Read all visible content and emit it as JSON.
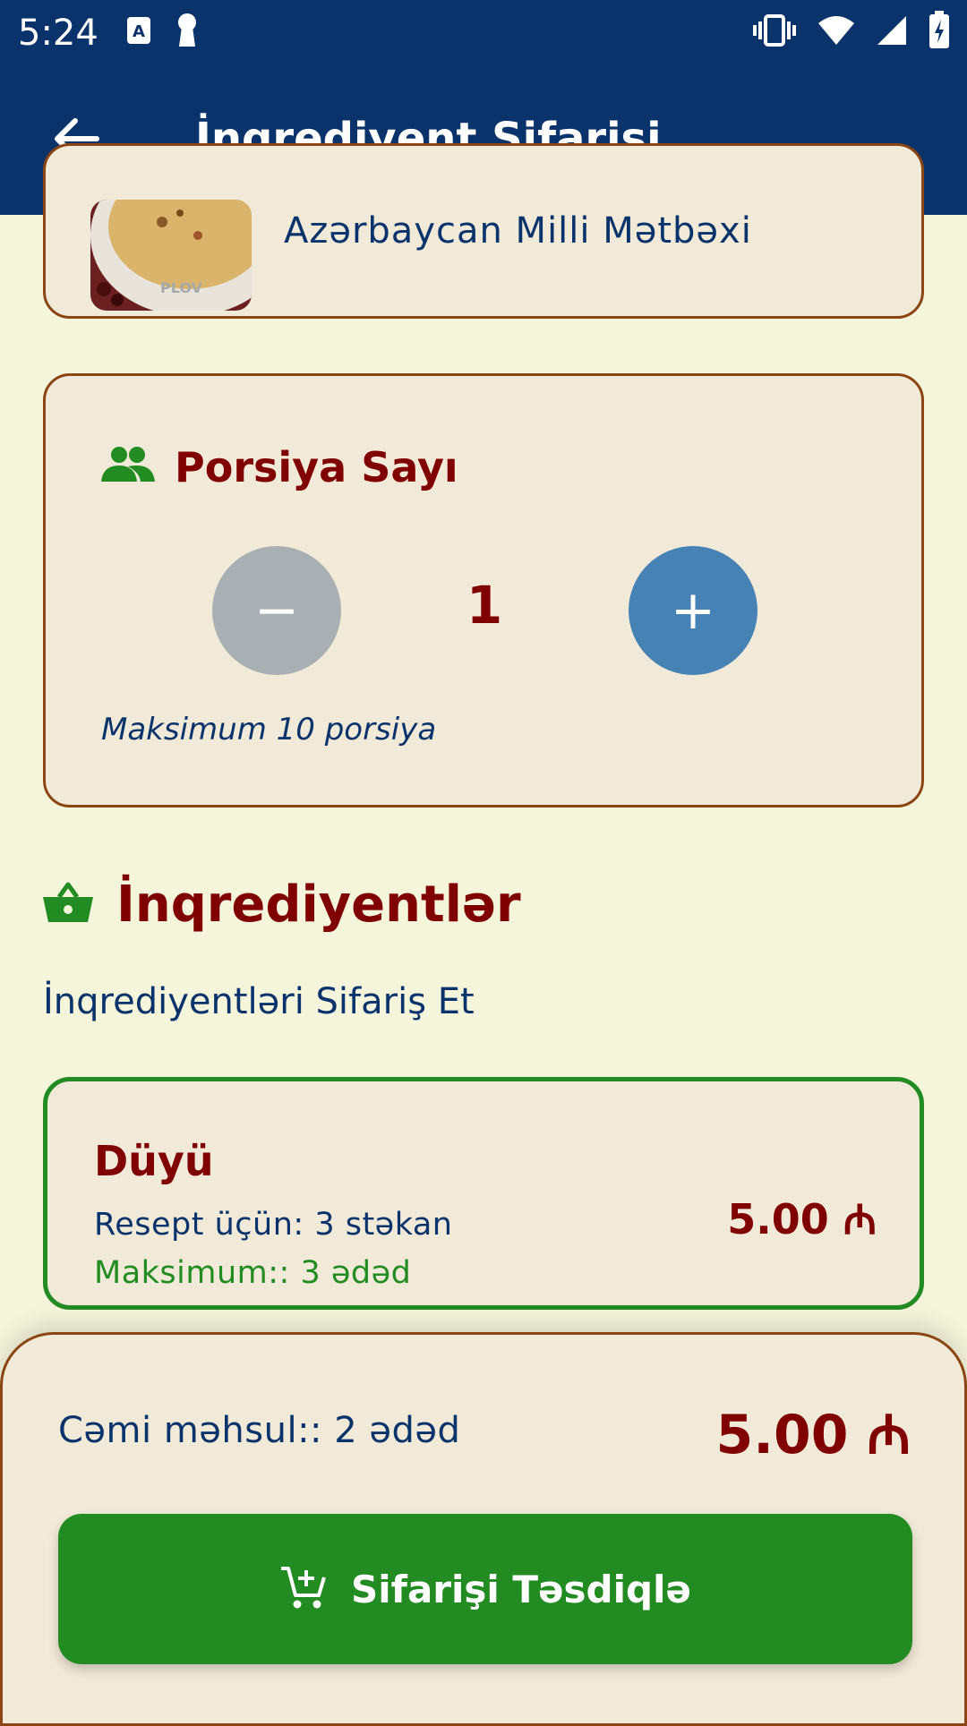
{
  "status_bar": {
    "time": "5:24"
  },
  "app_bar": {
    "title": "İnqrediyent Sifarişi"
  },
  "recipe": {
    "cuisine": "Azərbaycan Milli Mətbəxi",
    "thumb_text": "PLOV"
  },
  "portion": {
    "title": "Porsiya Sayı",
    "count": "1",
    "minus_label": "−",
    "plus_label": "+",
    "max_text": "Maksimum 10 porsiya"
  },
  "ingredients": {
    "title": "İnqrediyentlər",
    "subtitle": "İnqrediyentləri Sifariş Et",
    "items": [
      {
        "name": "Düyü",
        "recipe_qty": "Resept üçün: 3 stəkan",
        "max": "Maksimum:: 3 ədəd",
        "price": "5.00 ₼"
      }
    ]
  },
  "summary": {
    "total_label": "Cəmi məhsul:: 2 ədəd",
    "total_price": "5.00 ₼",
    "confirm_label": "Sifarişi Təsdiqlə"
  },
  "colors": {
    "app_bar": "#0A336B",
    "background": "#F5F5DC",
    "card": "#F2EAD8",
    "accent_red": "#800000",
    "accent_green": "#228B22",
    "plus_button": "#4682B4",
    "minus_button": "#A8B0B3"
  },
  "icons": [
    "back-arrow-icon",
    "people-icon",
    "basket-icon",
    "add-to-cart-icon",
    "vibrate-icon",
    "wifi-icon",
    "signal-icon",
    "battery-icon"
  ]
}
